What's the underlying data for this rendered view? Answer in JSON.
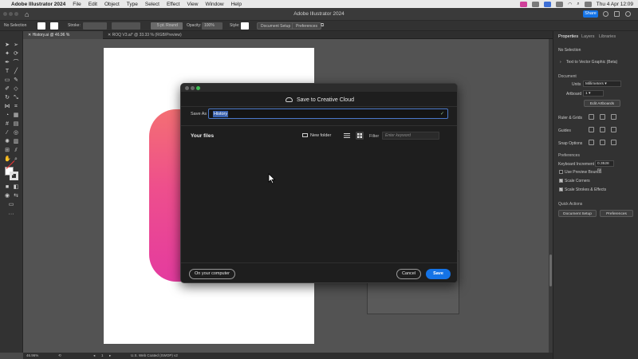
{
  "menubar": {
    "app_name": "Adobe Illustrator 2024",
    "items": [
      "File",
      "Edit",
      "Object",
      "Type",
      "Select",
      "Effect",
      "View",
      "Window",
      "Help"
    ],
    "clock": "Thu 4 Apr  12:09"
  },
  "titlebar": {
    "title": "Adobe Illustrator 2024",
    "share_label": "Share"
  },
  "controlbar": {
    "selection": "No Selection",
    "stroke_label": "Stroke:",
    "brush": "5 pt. Round",
    "opacity_label": "Opacity:",
    "opacity_value": "100%",
    "style_label": "Style:",
    "document_setup": "Document Setup",
    "preferences": "Preferences"
  },
  "tabs": [
    {
      "label": "History.ai @ 46.96 % (CMYK/Preview)",
      "active": true
    },
    {
      "label": "ROQ V3.ai* @ 33.33 % (RGB/Preview)",
      "active": false
    }
  ],
  "statusbar": {
    "zoom": "46.96%",
    "page": "1",
    "profile": "U.S. Web Coated (SWOP) v2"
  },
  "rpanel": {
    "tabs": [
      "Properties",
      "Layers",
      "Libraries"
    ],
    "no_selection": "No Selection",
    "text_to_vector": "Text to Vector Graphic (Beta)",
    "document_header": "Document",
    "units_label": "Units",
    "units_value": "Millimeters",
    "artboard_label": "Artboard",
    "artboard_value": "1",
    "edit_artboards": "Edit Artboards",
    "ruler_grids": "Ruler & Grids",
    "guides": "Guides",
    "snap_options": "Snap Options",
    "preferences_header": "Preferences",
    "keyboard_increment_label": "Keyboard Increment",
    "keyboard_increment_value": "0.3528 mi",
    "use_preview_bounds": "Use Preview Bounds",
    "scale_corners": "Scale Corners",
    "scale_strokes": "Scale Strokes & Effects",
    "quick_actions": "Quick Actions",
    "document_setup_btn": "Document Setup",
    "preferences_btn": "Preferences"
  },
  "dialog": {
    "title": "Save to Creative Cloud",
    "saveas_label": "Save As",
    "saveas_value": "History",
    "your_files": "Your files",
    "new_folder": "New folder",
    "filter_label": "Filter",
    "filter_placeholder": "Enter keyword",
    "on_your_computer": "On your computer",
    "cancel": "Cancel",
    "save": "Save"
  },
  "colors": {
    "accent": "#1473e6",
    "gradient_top": "#f46f73",
    "gradient_bottom": "#e43b9f"
  }
}
